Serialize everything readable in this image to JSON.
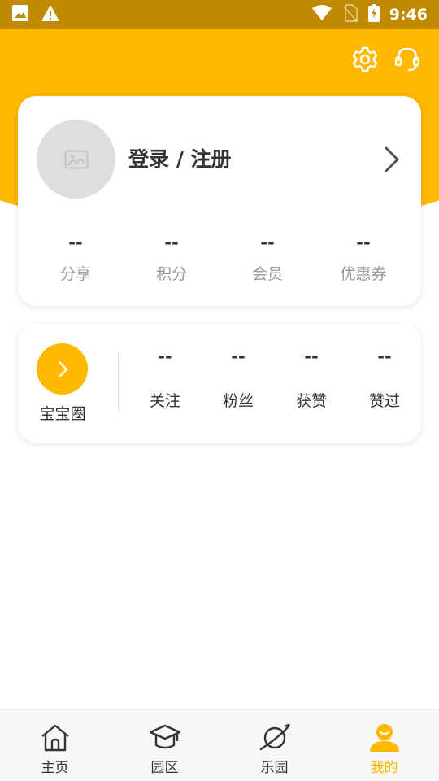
{
  "status_bar": {
    "time": "9:46",
    "left_icons": [
      "image-icon",
      "warning-icon"
    ],
    "right_icons": [
      "wifi-icon",
      "no-sim-icon",
      "battery-charging-icon"
    ]
  },
  "colors": {
    "accent": "#ffb700",
    "status_bar": "#c08a00",
    "text": "#333333",
    "muted": "#999999"
  },
  "header": {
    "icons": [
      "settings-icon",
      "customer-service-icon"
    ]
  },
  "profile": {
    "login_label": "登录 / 注册",
    "stats": [
      {
        "value": "--",
        "label": "分享"
      },
      {
        "value": "--",
        "label": "积分"
      },
      {
        "value": "--",
        "label": "会员"
      },
      {
        "value": "--",
        "label": "优惠券"
      }
    ]
  },
  "circle": {
    "label": "宝宝圈",
    "stats": [
      {
        "value": "--",
        "label": "关注"
      },
      {
        "value": "--",
        "label": "粉丝"
      },
      {
        "value": "--",
        "label": "获赞"
      },
      {
        "value": "--",
        "label": "赞过"
      }
    ]
  },
  "tabbar": {
    "tabs": [
      {
        "label": "主页",
        "icon": "home-icon"
      },
      {
        "label": "园区",
        "icon": "graduation-cap-icon"
      },
      {
        "label": "乐园",
        "icon": "planet-icon"
      },
      {
        "label": "我的",
        "icon": "user-icon",
        "active": true
      }
    ]
  }
}
